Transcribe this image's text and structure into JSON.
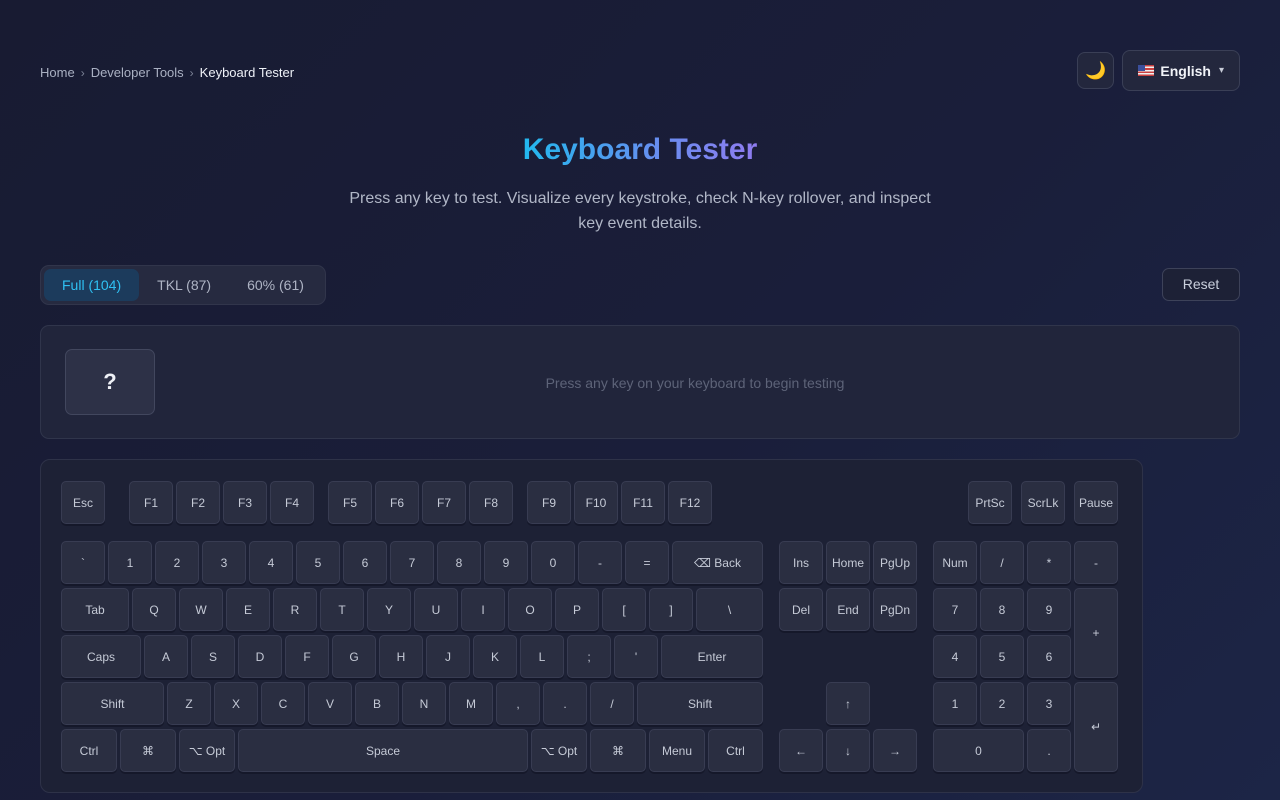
{
  "breadcrumb": [
    {
      "label": "Home",
      "current": false
    },
    {
      "label": "Developer Tools",
      "current": false
    },
    {
      "label": "Keyboard Tester",
      "current": true
    }
  ],
  "breadcrumb_separator": "›",
  "theme_toggle": {
    "icon": "moon-icon",
    "glyph": "🌙"
  },
  "language": {
    "flag": "us-flag-icon",
    "label": "English",
    "caret": "▾"
  },
  "title": "Keyboard Tester",
  "subtitle": "Press any key to test. Visualize every keystroke, check N-key rollover, and inspect key event details.",
  "layouts": [
    {
      "label": "Full (104)",
      "active": true
    },
    {
      "label": "TKL (87)",
      "active": false
    },
    {
      "label": "60% (61)",
      "active": false
    }
  ],
  "reset_label": "Reset",
  "last_key": {
    "glyph": "?",
    "hint": "Press any key on your keyboard to begin testing"
  },
  "colors": {
    "accent": "#2fc0f2",
    "title_gradient_start": "#22b8ee",
    "title_gradient_end": "#8f7cf0"
  },
  "keys": {
    "fn": [
      "Esc",
      "F1",
      "F2",
      "F3",
      "F4",
      "F5",
      "F6",
      "F7",
      "F8",
      "F9",
      "F10",
      "F11",
      "F12",
      "PrtSc",
      "ScrLk",
      "Pause"
    ],
    "num_row": [
      "`",
      "1",
      "2",
      "3",
      "4",
      "5",
      "6",
      "7",
      "8",
      "9",
      "0",
      "-",
      "=",
      "⌫ Back"
    ],
    "tab_row": [
      "Tab",
      "Q",
      "W",
      "E",
      "R",
      "T",
      "Y",
      "U",
      "I",
      "O",
      "P",
      "[",
      "]",
      "\\"
    ],
    "caps_row": [
      "Caps",
      "A",
      "S",
      "D",
      "F",
      "G",
      "H",
      "J",
      "K",
      "L",
      ";",
      "'",
      "Enter"
    ],
    "shift_row": [
      "Shift",
      "Z",
      "X",
      "C",
      "V",
      "B",
      "N",
      "M",
      ",",
      ".",
      "/",
      "Shift"
    ],
    "bottom_row": [
      "Ctrl",
      "⌘",
      "⌥ Opt",
      "Space",
      "⌥ Opt",
      "⌘",
      "Menu",
      "Ctrl"
    ],
    "nav_top": [
      "Ins",
      "Home",
      "PgUp"
    ],
    "nav_bottom": [
      "Del",
      "End",
      "PgDn"
    ],
    "arrows": [
      "↑",
      "←",
      "↓",
      "→"
    ],
    "numpad": [
      "Num",
      "/",
      "*",
      "-",
      "7",
      "8",
      "9",
      "+",
      "4",
      "5",
      "6",
      "1",
      "2",
      "3",
      "↵",
      "0",
      "."
    ]
  }
}
